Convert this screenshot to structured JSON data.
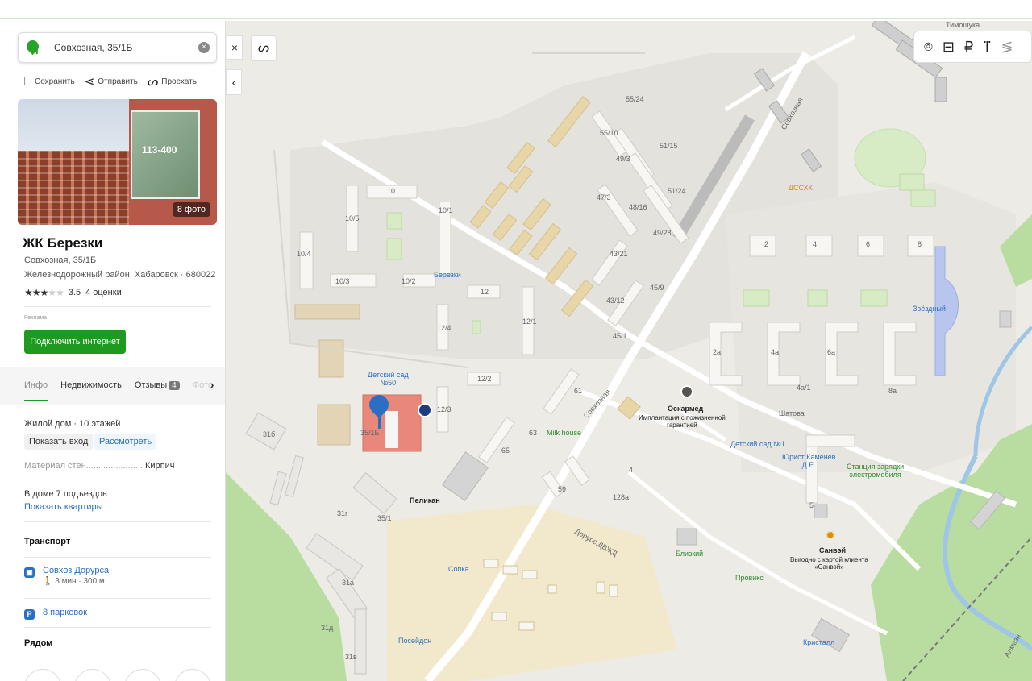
{
  "search": {
    "value": "Совхозная, 35/1Б"
  },
  "actions": {
    "save": "Сохранить",
    "share": "Отправить",
    "route": "Проехать"
  },
  "photo": {
    "count": "8 фото",
    "billboard_text": "113-400"
  },
  "place": {
    "title": "ЖК Березки",
    "address": "Совхозная, 35/1Б",
    "district": "Железнодорожный район, Хабаровск · 680022",
    "rating": "3.5",
    "reviews": "4 оценки"
  },
  "ad": {
    "label": "Реклама",
    "button": "Подключить интернет"
  },
  "tabs": [
    {
      "label": "Инфо"
    },
    {
      "label": "Недвижимость"
    },
    {
      "label": "Отзывы",
      "count": "4"
    },
    {
      "label": "Фото"
    }
  ],
  "info": {
    "house": "Жилой дом · 10 этажей",
    "show_entrance": "Показать вход",
    "view": "Рассмотреть",
    "material_label": "Материал стен",
    "material_value": "Кирпич",
    "entrances": "В доме 7 подъездов",
    "show_apartments": "Показать квартиры"
  },
  "transport": {
    "title": "Транспорт",
    "stop": "Совхоз Дорурса",
    "stop_detail": "🚶 3 мин · 300 м",
    "parking": "8 парковок"
  },
  "nearby": {
    "title": "Рядом"
  },
  "map": {
    "places": [
      {
        "name": "Березки"
      },
      {
        "name": "Детский сад\n№50"
      },
      {
        "name": "Пеликан"
      },
      {
        "name": "Milk house"
      },
      {
        "name": "Сопка"
      },
      {
        "name": "Посейдон"
      },
      {
        "name": "Оскармед"
      },
      {
        "name": "Имплантация с пожизненной\nгарантией"
      },
      {
        "name": "Детский сад №1"
      },
      {
        "name": "Юрист Каменев\nД.Е."
      },
      {
        "name": "Станция зарядки\nэлектромобиля"
      },
      {
        "name": "Санвэй"
      },
      {
        "name": "Выгодно с картой клиента\n«Санвэй»"
      },
      {
        "name": "Близкий"
      },
      {
        "name": "Провикс"
      },
      {
        "name": "Кристалл"
      },
      {
        "name": "Звёздный"
      },
      {
        "name": "ДССХК"
      }
    ],
    "streets": [
      "Совхозная",
      "Совхозная",
      "Шатова",
      "Дорурс.ДВЖД",
      "Тимошука",
      "Алмазн"
    ],
    "house_numbers": [
      "10",
      "10/5",
      "10/4",
      "10/3",
      "10/2",
      "10/1",
      "12",
      "12/1",
      "12/4",
      "12/2",
      "12/3",
      "35/1Б",
      "35/1",
      "31б",
      "31г",
      "31а",
      "31д",
      "31в",
      "55/24",
      "55/10",
      "49/3",
      "51/15",
      "51/24",
      "47/3",
      "48/16",
      "49/28",
      "43/21",
      "43/12",
      "45/9",
      "45/1",
      "61",
      "65",
      "63",
      "59",
      "128а",
      "4",
      "2",
      "4",
      "6",
      "8",
      "2а",
      "4а",
      "4а/1",
      "6а",
      "8а",
      "5"
    ]
  }
}
